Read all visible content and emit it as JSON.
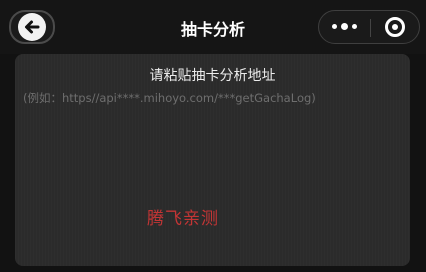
{
  "header": {
    "title": "抽卡分析",
    "back_icon": "arrow-left-icon",
    "more_icon": "more-dots-icon",
    "close_icon": "close-circle-icon"
  },
  "card": {
    "title": "请粘贴抽卡分析地址",
    "input_placeholder": "(例如：https//api****.mihoyo.com/***getGachaLog)",
    "input_value": ""
  },
  "watermark": "腾飞亲测",
  "colors": {
    "background": "#121212",
    "card": "#2b2b2b",
    "watermark": "#c43535"
  }
}
